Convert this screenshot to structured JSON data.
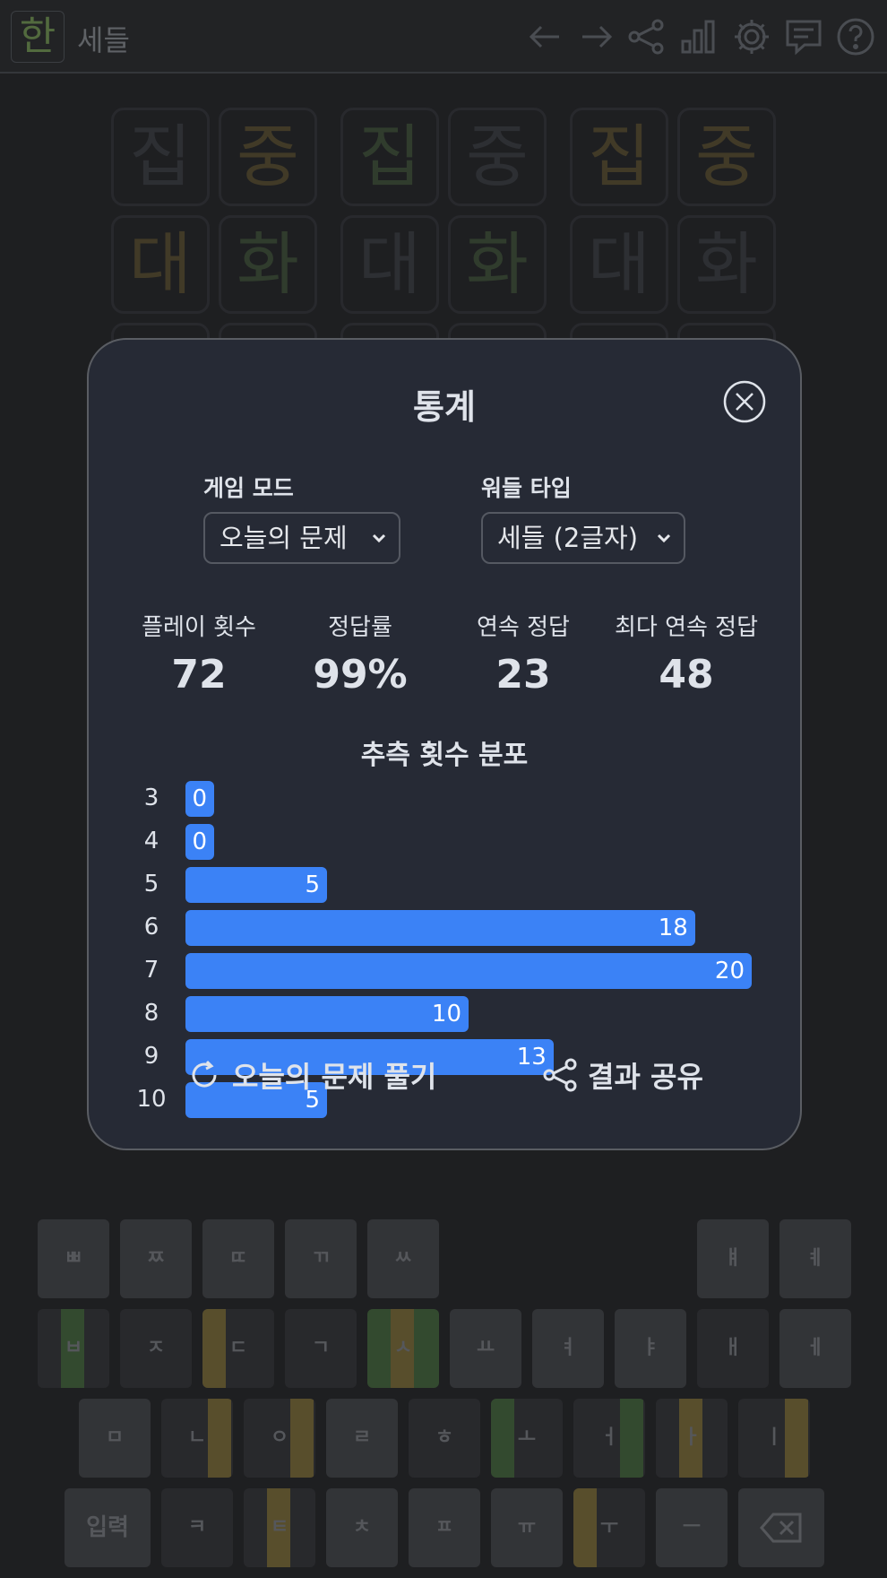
{
  "app": {
    "logo": "한",
    "title": "세들"
  },
  "header_icons": [
    "arrow-left-icon",
    "arrow-right-icon",
    "share-icon",
    "bar-chart-icon",
    "gear-icon",
    "message-icon",
    "help-icon"
  ],
  "board": {
    "rows": [
      [
        "집",
        "중",
        "집",
        "중",
        "집",
        "중"
      ],
      [
        "대",
        "화",
        "대",
        "화",
        "대",
        "화"
      ]
    ]
  },
  "modal": {
    "title": "통계",
    "game_mode": {
      "label": "게임 모드",
      "value": "오늘의 문제"
    },
    "wordle_type": {
      "label": "워들 타입",
      "value": "세들 (2글자)"
    },
    "stats": [
      {
        "label": "플레이 횟수",
        "value": "72"
      },
      {
        "label": "정답률",
        "value": "99%"
      },
      {
        "label": "연속 정답",
        "value": "23"
      },
      {
        "label": "최다 연속 정답",
        "value": "48"
      }
    ],
    "distribution_title": "추측 횟수 분포",
    "play_today_label": "오늘의 문제 풀기",
    "share_label": "결과 공유"
  },
  "chart_data": {
    "type": "bar",
    "orientation": "horizontal",
    "categories": [
      "3",
      "4",
      "5",
      "6",
      "7",
      "8",
      "9",
      "10"
    ],
    "values": [
      0,
      0,
      5,
      18,
      20,
      10,
      13,
      5
    ],
    "title": "추측 횟수 분포"
  },
  "keyboard": {
    "rows": [
      [
        "ㅃ",
        "ㅉ",
        "ㄸ",
        "ㄲ",
        "ㅆ",
        "ㅒ",
        "ㅖ"
      ],
      [
        "ㅂ",
        "ㅈ",
        "ㄷ",
        "ㄱ",
        "ㅅ",
        "ㅛ",
        "ㅕ",
        "ㅑ",
        "ㅐ",
        "ㅔ"
      ],
      [
        "ㅁ",
        "ㄴ",
        "ㅇ",
        "ㄹ",
        "ㅎ",
        "ㅗ",
        "ㅓ",
        "ㅏ",
        "ㅣ"
      ],
      [
        "입력",
        "ㅋ",
        "ㅌ",
        "ㅊ",
        "ㅍ",
        "ㅠ",
        "ㅜ",
        "ㅡ"
      ]
    ],
    "backspace_icon": "backspace-icon"
  },
  "colors": {
    "accent": "#3b82f6",
    "panel": "#262a35",
    "background": "#222325",
    "green": "#4a6a3f",
    "yellow": "#8c7a3a"
  }
}
